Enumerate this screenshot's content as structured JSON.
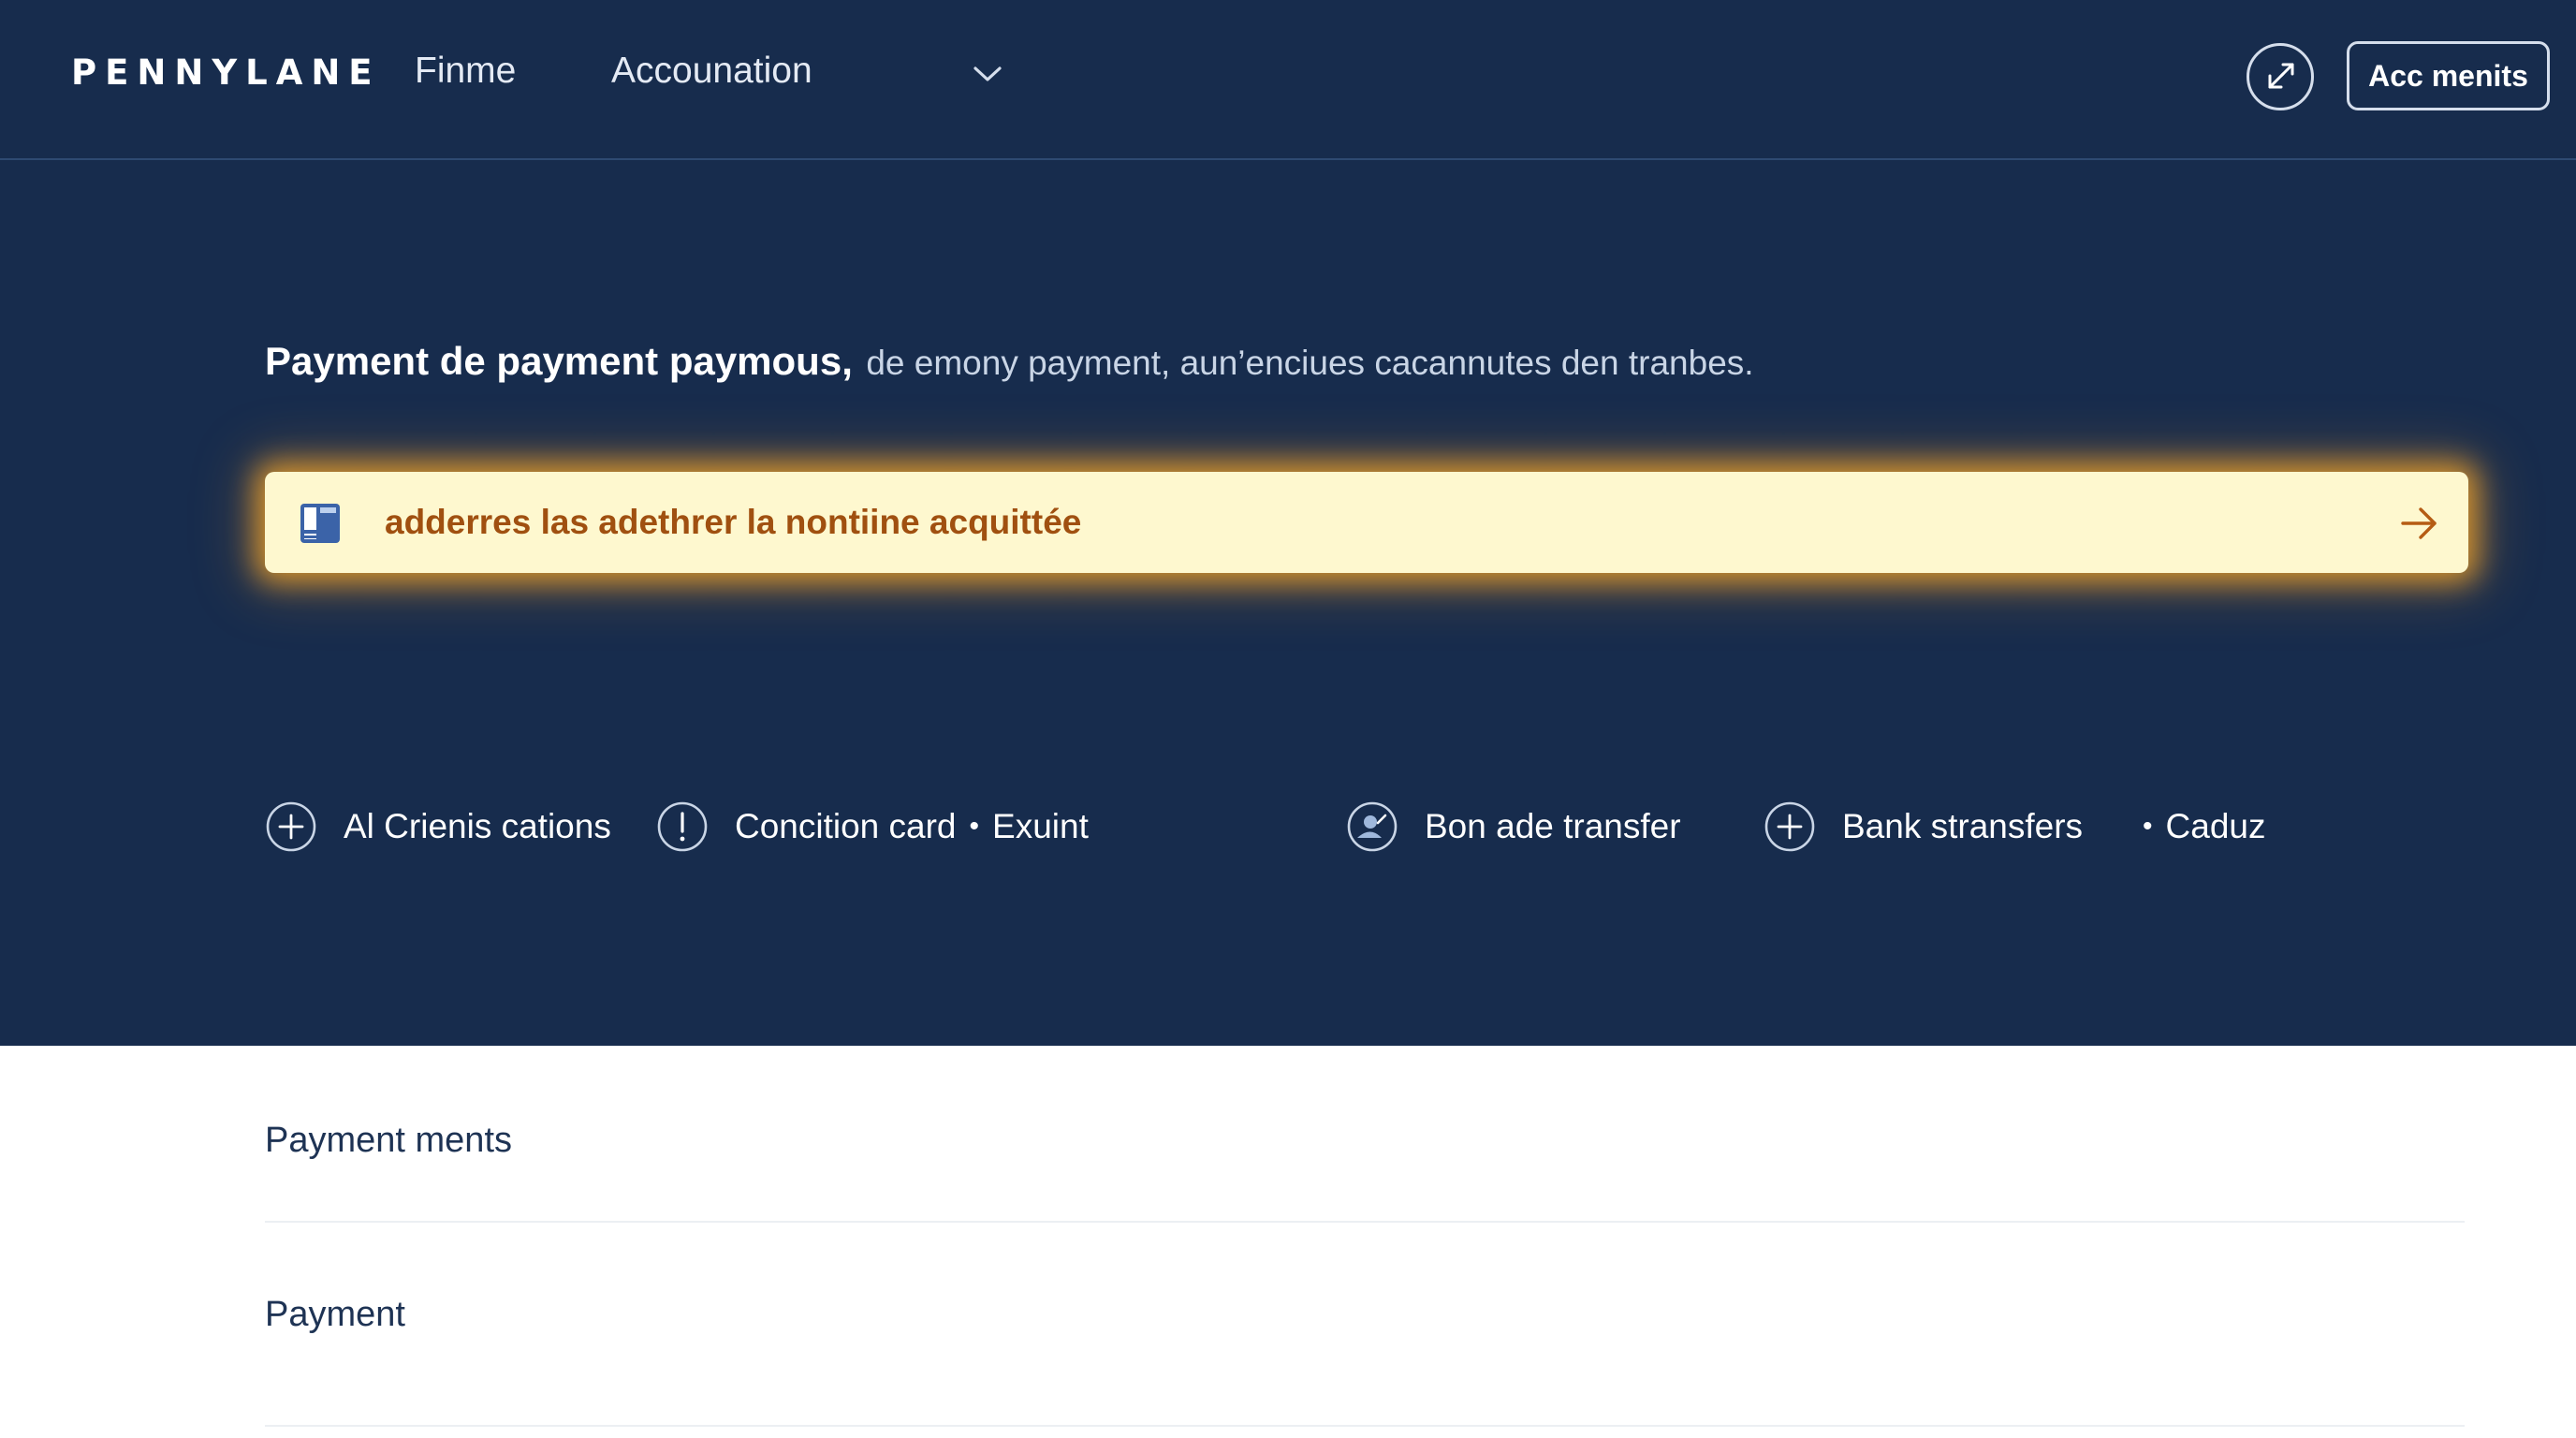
{
  "header": {
    "logo": "PENNYLANE",
    "nav": [
      {
        "label": "Finme"
      },
      {
        "label": "Accounation"
      }
    ],
    "external_link_icon": "external-link-icon",
    "account_button": "Acc menits"
  },
  "hero": {
    "intro_strong": "Payment de payment paymous",
    "intro_separator": ",",
    "intro_rest": "de emony payment, aun’enciues cacannutes den tranbes.",
    "banner": {
      "icon": "document-icon",
      "text": "adderres las adethrer la nontiine acquittée",
      "arrow_icon": "arrow-right-icon"
    },
    "actions": [
      {
        "icon": "plus-circle-icon",
        "label": "Al Crienis cations"
      },
      {
        "icon": "alert-circle-icon",
        "label": "Concition card",
        "extra": "Exuint"
      },
      {
        "icon": "user-circle-icon",
        "label": "Bon ade transfer"
      },
      {
        "icon": "plus-circle-icon",
        "label": "Bank stransfers"
      },
      {
        "icon": "dot-icon",
        "label": "Caduz"
      }
    ]
  },
  "content": {
    "rows": [
      {
        "label": "Payment ments"
      },
      {
        "label": "Payment"
      }
    ]
  },
  "colors": {
    "hero_bg": "#172c4d",
    "banner_bg": "#fef8cf",
    "banner_glow": "#ffac28",
    "banner_text": "#a05010",
    "content_text": "#1e3354"
  }
}
